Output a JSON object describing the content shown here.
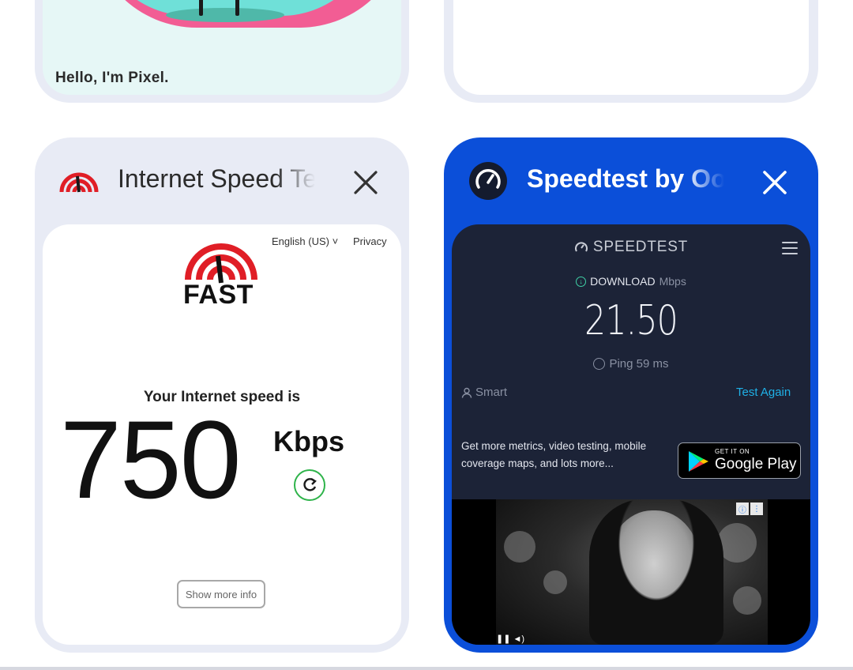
{
  "recents": {
    "top_left_card": {
      "caption": "Hello, I'm Pixel."
    },
    "fast_card": {
      "app_title": "Internet Speed Test",
      "page": {
        "language": "English (US) ˅",
        "privacy_link": "Privacy",
        "logo_text": "FAST",
        "speed_label": "Your Internet speed is",
        "speed_value": "750",
        "speed_unit": "Kbps",
        "show_more_button": "Show more info"
      }
    },
    "speedtest_card": {
      "app_title": "Speedtest by Ookla",
      "page": {
        "brand": "SPEEDTEST",
        "download_label": "DOWNLOAD",
        "download_unit": "Mbps",
        "download_value": "21.50",
        "ping_text": "Ping 59 ms",
        "connection_label": "Smart",
        "test_again_link": "Test Again",
        "promo_text": "Get more metrics, video testing, mobile coverage maps, and lots more...",
        "store_badge_top": "GET IT ON",
        "store_badge_main": "Google Play"
      }
    }
  },
  "colors": {
    "card_gray": "#e8ebf5",
    "card_blue": "#0b4fd9",
    "speedtest_bg": "#1c2337",
    "fast_red": "#e01e26",
    "accent_cyan": "#1fb0e6"
  }
}
